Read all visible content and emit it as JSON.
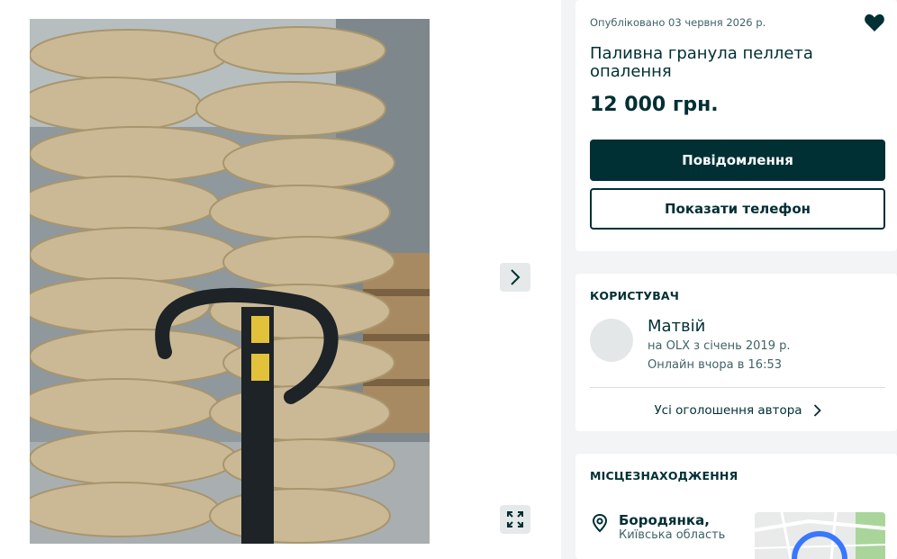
{
  "offer": {
    "published": "Опубліковано 03 червня 2026 р.",
    "title": "Паливна гранула пеллета опалення",
    "price": "12 000 грн.",
    "message_button": "Повідомлення",
    "phone_button": "Показати телефон"
  },
  "user": {
    "heading": "КОРИСТУВАЧ",
    "name": "Матвій",
    "since": "на OLX з січень 2019 р.",
    "online": "Онлайн вчора в 16:53",
    "all_ads": "Усі оголошення автора"
  },
  "location": {
    "heading": "МІСЦЕЗНАХОДЖЕННЯ",
    "city": "Бородянка,",
    "region": "Київська область"
  },
  "icons": {
    "favorite": "heart-icon",
    "next": "chevron-right-icon",
    "fullscreen": "expand-icon",
    "location": "map-pin-icon"
  },
  "colors": {
    "primary": "#002f34",
    "background": "#f2f4f5",
    "muted_text": "#406367",
    "map_marker": "#3a77ff"
  }
}
